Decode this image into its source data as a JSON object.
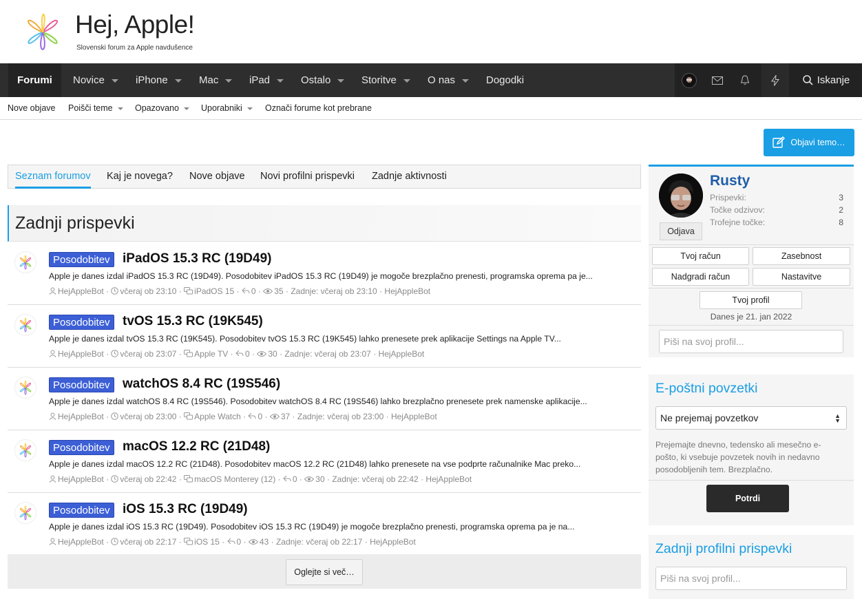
{
  "header": {
    "logo_title": "Hej, Apple!",
    "logo_subtitle": "Slovenski forum za Apple navdušence"
  },
  "nav": {
    "items": [
      {
        "label": "Forumi",
        "active": true
      },
      {
        "label": "Novice",
        "dropdown": true
      },
      {
        "label": "iPhone",
        "dropdown": true
      },
      {
        "label": "Mac",
        "dropdown": true
      },
      {
        "label": "iPad",
        "dropdown": true
      },
      {
        "label": "Ostalo",
        "dropdown": true
      },
      {
        "label": "Storitve",
        "dropdown": true
      },
      {
        "label": "O nas",
        "dropdown": true
      },
      {
        "label": "Dogodki"
      }
    ],
    "icons": [
      "avatar",
      "envelope-icon",
      "bell-icon",
      "bolt-icon"
    ],
    "search_label": "Iskanje"
  },
  "subnav": {
    "items": [
      {
        "label": "Nove objave"
      },
      {
        "label": "Poišči teme",
        "dropdown": true
      },
      {
        "label": "Opazovano",
        "dropdown": true
      },
      {
        "label": "Uporabniki",
        "dropdown": true
      },
      {
        "label": "Označi forume kot prebrane"
      }
    ]
  },
  "post_thread_button": "Objavi temo…",
  "tabs": [
    {
      "label": "Seznam forumov",
      "selected": true
    },
    {
      "label": "Kaj je novega?"
    },
    {
      "label": "Nove objave"
    },
    {
      "label": "Novi profilni prispevki"
    },
    {
      "label": "Zadnje aktivnosti"
    }
  ],
  "main": {
    "heading": "Zadnji prispevki",
    "threads": [
      {
        "prefix": "Posodobitev",
        "title": "iPadOS 15.3 RC (19D49)",
        "snippet": "Apple je danes izdal iPadOS 15.3 RC (19D49). Posodobitev iPadOS 15.3 RC (19D49) je mogoče brezplačno prenesti, programska oprema pa je...",
        "author": "HejAppleBot",
        "time": "včeraj ob 23:10",
        "forum": "iPadOS 15",
        "replies": "0",
        "views": "35",
        "last": "Zadnje: včeraj ob 23:10",
        "last_user": "HejAppleBot"
      },
      {
        "prefix": "Posodobitev",
        "title": "tvOS 15.3 RC (19K545)",
        "snippet": "Apple je danes izdal tvOS 15.3 RC (19K545). Posodobitev tvOS 15.3 RC (19K545) lahko prenesete prek aplikacije Settings na Apple TV...",
        "author": "HejAppleBot",
        "time": "včeraj ob 23:07",
        "forum": "Apple TV",
        "replies": "0",
        "views": "30",
        "last": "Zadnje: včeraj ob 23:07",
        "last_user": "HejAppleBot"
      },
      {
        "prefix": "Posodobitev",
        "title": "watchOS 8.4 RC (19S546)",
        "snippet": "Apple je danes izdal watchOS 8.4 RC (19S546). Posodobitev watchOS 8.4 RC (19S546) lahko brezplačno prenesete prek namenske aplikacije...",
        "author": "HejAppleBot",
        "time": "včeraj ob 23:00",
        "forum": "Apple Watch",
        "replies": "0",
        "views": "37",
        "last": "Zadnje: včeraj ob 23:00",
        "last_user": "HejAppleBot"
      },
      {
        "prefix": "Posodobitev",
        "title": "macOS 12.2 RC (21D48)",
        "snippet": "Apple je danes izdal macOS 12.2 RC (21D48). Posodobitev macOS 12.2 RC (21D48) lahko prenesete na vse podprte računalnike Mac preko...",
        "author": "HejAppleBot",
        "time": "včeraj ob 22:42",
        "forum": "macOS Monterey (12)",
        "replies": "0",
        "views": "30",
        "last": "Zadnje: včeraj ob 22:42",
        "last_user": "HejAppleBot"
      },
      {
        "prefix": "Posodobitev",
        "title": "iOS 15.3 RC (19D49)",
        "snippet": "Apple je danes izdal iOS 15.3 RC (19D49). Posodobitev iOS 15.3 RC (19D49) je mogoče brezplačno prenesti, programska oprema pa je na...",
        "author": "HejAppleBot",
        "time": "včeraj ob 22:17",
        "forum": "iOS 15",
        "replies": "0",
        "views": "43",
        "last": "Zadnje: včeraj ob 22:17",
        "last_user": "HejAppleBot"
      }
    ],
    "more_button": "Oglejte si več…"
  },
  "sidebar": {
    "user": {
      "name": "Rusty",
      "stats": [
        {
          "label": "Prispevki:",
          "value": "3"
        },
        {
          "label": "Točke odzivov:",
          "value": "2"
        },
        {
          "label": "Trofejne točke:",
          "value": "8"
        }
      ],
      "logout": "Odjava",
      "buttons": [
        "Tvoj račun",
        "Zasebnost",
        "Nadgradi račun",
        "Nastavitve"
      ],
      "profile_button": "Tvoj profil",
      "today": "Danes je 21. jan 2022",
      "profile_placeholder": "Piši na svoj profil..."
    },
    "digest": {
      "title": "E-poštni povzetki",
      "selected": "Ne prejemaj povzetkov",
      "description": "Prejemajte dnevno, tedensko ali mesečno e-pošto, ki vsebuje povzetek novih in nedavno posodobljenih tem. Brezplačno.",
      "confirm": "Potrdi"
    },
    "profile_posts": {
      "title": "Zadnji profilni prispevki",
      "placeholder": "Piši na svoj profil..."
    }
  },
  "colors": {
    "accent": "#1a9ee4",
    "nav_bg": "#2e2e2e",
    "prefix_badge": "#3c5fd6",
    "username": "#1f5ea8"
  }
}
